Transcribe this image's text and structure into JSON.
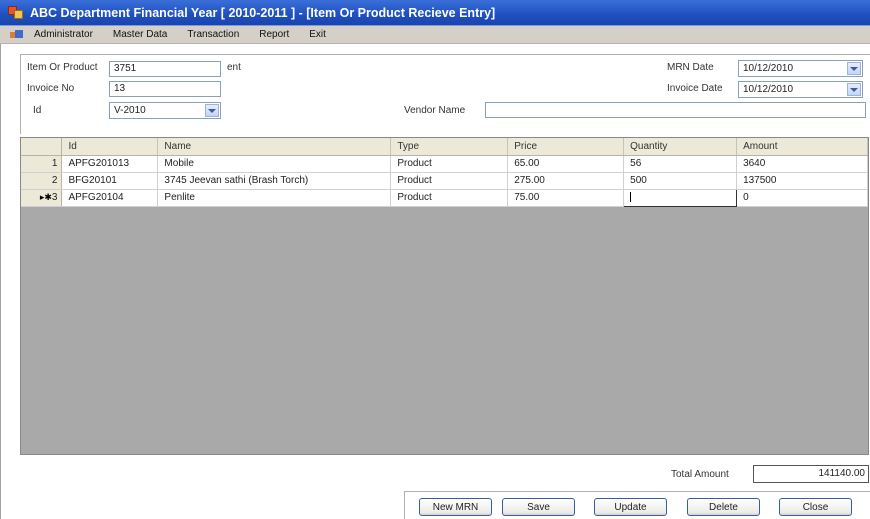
{
  "window": {
    "title": "ABC Department Financial Year [ 2010-2011 ] - [Item Or Product Recieve Entry]"
  },
  "menu": [
    "Administrator",
    "Master Data",
    "Transaction",
    "Report",
    "Exit"
  ],
  "form": {
    "item_label": "Item Or Product",
    "item_value": "3751",
    "item_suffix": "ent",
    "invoice_no_label": "Invoice No",
    "invoice_no_value": "13",
    "id_label": "Id",
    "id_value": "V-2010",
    "vendor_name_label": "Vendor Name",
    "vendor_name_value": "",
    "mrn_date_label": "MRN Date",
    "mrn_date_value": "10/12/2010",
    "invoice_date_label": "Invoice Date",
    "invoice_date_value": "10/12/2010"
  },
  "grid": {
    "columns": [
      "Id",
      "Name",
      "Type",
      "Price",
      "Quantity",
      "Amount"
    ],
    "rows": [
      {
        "num": "1",
        "id": "APFG201013",
        "name": "Mobile",
        "type": "Product",
        "price": "65.00",
        "quantity": "56",
        "amount": "3640"
      },
      {
        "num": "2",
        "id": "BFG20101",
        "name": "3745 Jeevan sathi (Brash Torch)",
        "type": "Product",
        "price": "275.00",
        "quantity": "500",
        "amount": "137500"
      },
      {
        "num": "3",
        "marker": "▸✱",
        "id": "APFG20104",
        "name": "Penlite",
        "type": "Product",
        "price": "75.00",
        "quantity": "",
        "amount": "0"
      }
    ]
  },
  "total": {
    "label": "Total Amount",
    "value": "141140.00"
  },
  "buttons": {
    "new_mrn": "New MRN",
    "save": "Save",
    "update": "Update",
    "delete": "Delete",
    "close": "Close"
  }
}
